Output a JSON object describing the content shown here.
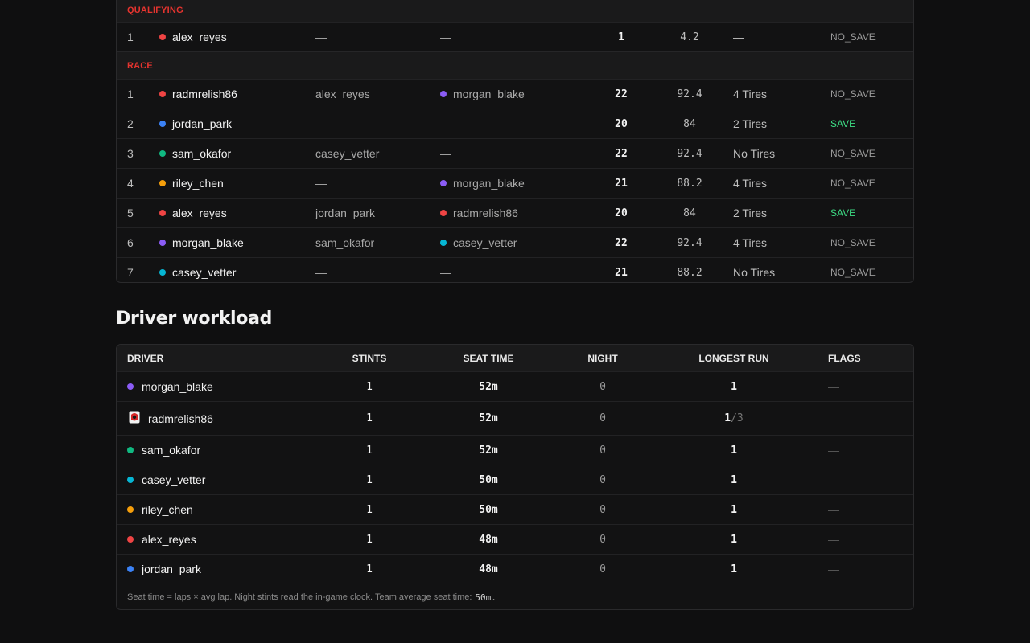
{
  "stints": {
    "sections": [
      {
        "label": "QUALIFYING",
        "rows": [
          {
            "pos": "1",
            "driver": "alex_reyes",
            "driver_color": "#ef4444",
            "with": "—",
            "with_color": "",
            "sub": "—",
            "sub_color": "",
            "laps": "1",
            "fuel": "4.2",
            "tires": "—",
            "save": "NO_SAVE"
          }
        ]
      },
      {
        "label": "RACE",
        "rows": [
          {
            "pos": "1",
            "driver": "radmrelish86",
            "driver_color": "#ef4444",
            "with": "alex_reyes",
            "with_color": "",
            "sub": "morgan_blake",
            "sub_color": "#8b5cf6",
            "laps": "22",
            "fuel": "92.4",
            "tires": "4 Tires",
            "save": "NO_SAVE"
          },
          {
            "pos": "2",
            "driver": "jordan_park",
            "driver_color": "#3b82f6",
            "with": "—",
            "with_color": "",
            "sub": "—",
            "sub_color": "",
            "laps": "20",
            "fuel": "84",
            "tires": "2 Tires",
            "save": "SAVE"
          },
          {
            "pos": "3",
            "driver": "sam_okafor",
            "driver_color": "#10b981",
            "with": "casey_vetter",
            "with_color": "",
            "sub": "—",
            "sub_color": "",
            "laps": "22",
            "fuel": "92.4",
            "tires": "No Tires",
            "save": "NO_SAVE"
          },
          {
            "pos": "4",
            "driver": "riley_chen",
            "driver_color": "#f59e0b",
            "with": "—",
            "with_color": "",
            "sub": "morgan_blake",
            "sub_color": "#8b5cf6",
            "laps": "21",
            "fuel": "88.2",
            "tires": "4 Tires",
            "save": "NO_SAVE"
          },
          {
            "pos": "5",
            "driver": "alex_reyes",
            "driver_color": "#ef4444",
            "with": "jordan_park",
            "with_color": "",
            "sub": "radmrelish86",
            "sub_color": "#ef4444",
            "laps": "20",
            "fuel": "84",
            "tires": "2 Tires",
            "save": "SAVE"
          },
          {
            "pos": "6",
            "driver": "morgan_blake",
            "driver_color": "#8b5cf6",
            "with": "sam_okafor",
            "with_color": "",
            "sub": "casey_vetter",
            "sub_color": "#06b6d4",
            "laps": "22",
            "fuel": "92.4",
            "tires": "4 Tires",
            "save": "NO_SAVE"
          },
          {
            "pos": "7",
            "driver": "casey_vetter",
            "driver_color": "#06b6d4",
            "with": "—",
            "with_color": "",
            "sub": "—",
            "sub_color": "",
            "laps": "21",
            "fuel": "88.2",
            "tires": "No Tires",
            "save": "NO_SAVE"
          }
        ]
      }
    ]
  },
  "workload": {
    "title": "Driver workload",
    "headers": {
      "driver": "DRIVER",
      "stints": "STINTS",
      "seat": "SEAT TIME",
      "night": "NIGHT",
      "longest": "LONGEST RUN",
      "flags": "FLAGS"
    },
    "rows": [
      {
        "driver": "morgan_blake",
        "color": "#8b5cf6",
        "avatar": false,
        "stints": "1",
        "seat": "52m",
        "night": "0",
        "longest": "1",
        "longest_of": "",
        "flags": "—"
      },
      {
        "driver": "radmrelish86",
        "color": "#ef4444",
        "avatar": true,
        "stints": "1",
        "seat": "52m",
        "night": "0",
        "longest": "1",
        "longest_of": "/3",
        "flags": "—"
      },
      {
        "driver": "sam_okafor",
        "color": "#10b981",
        "avatar": false,
        "stints": "1",
        "seat": "52m",
        "night": "0",
        "longest": "1",
        "longest_of": "",
        "flags": "—"
      },
      {
        "driver": "casey_vetter",
        "color": "#06b6d4",
        "avatar": false,
        "stints": "1",
        "seat": "50m",
        "night": "0",
        "longest": "1",
        "longest_of": "",
        "flags": "—"
      },
      {
        "driver": "riley_chen",
        "color": "#f59e0b",
        "avatar": false,
        "stints": "1",
        "seat": "50m",
        "night": "0",
        "longest": "1",
        "longest_of": "",
        "flags": "—"
      },
      {
        "driver": "alex_reyes",
        "color": "#ef4444",
        "avatar": false,
        "stints": "1",
        "seat": "48m",
        "night": "0",
        "longest": "1",
        "longest_of": "",
        "flags": "—"
      },
      {
        "driver": "jordan_park",
        "color": "#3b82f6",
        "avatar": false,
        "stints": "1",
        "seat": "48m",
        "night": "0",
        "longest": "1",
        "longest_of": "",
        "flags": "—"
      }
    ],
    "footnote": "Seat time = laps × avg lap. Night stints read the in-game clock. Team average seat time:",
    "footnote_value": "50m."
  },
  "colors": {
    "accent_red": "#e5342f",
    "save_green": "#3ddc84",
    "background": "#0f0f10"
  }
}
